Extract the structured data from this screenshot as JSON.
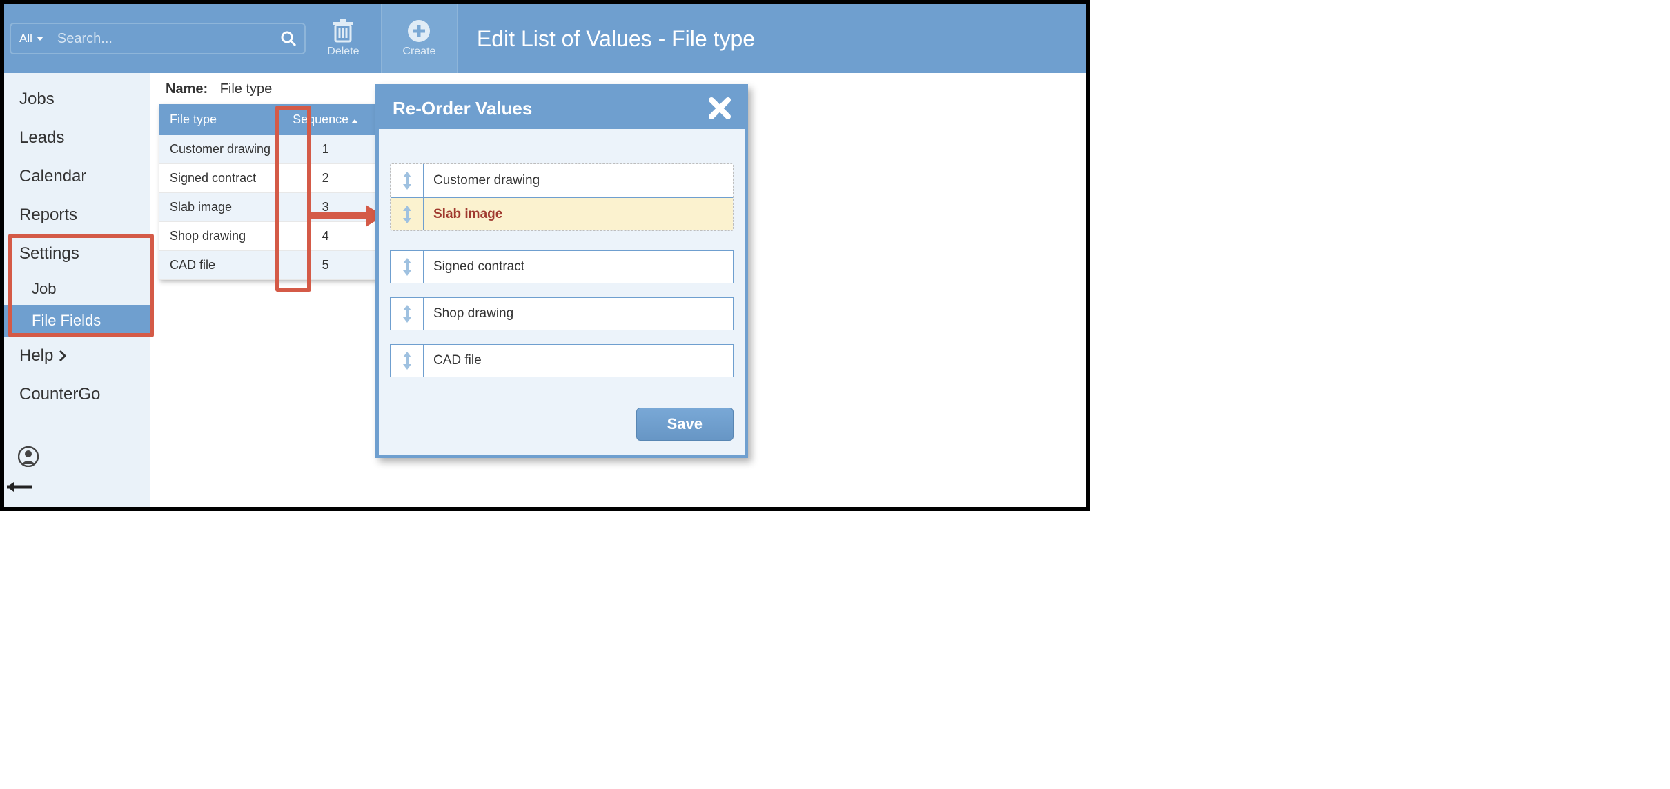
{
  "header": {
    "search_filter": "All",
    "search_placeholder": "Search...",
    "delete_label": "Delete",
    "create_label": "Create",
    "title": "Edit List of Values - File type"
  },
  "sidebar": {
    "items": [
      "Jobs",
      "Leads",
      "Calendar",
      "Reports",
      "Settings"
    ],
    "sub_items": [
      "Job",
      "File Fields"
    ],
    "help_label": "Help",
    "countergo_label": "CounterGo"
  },
  "main": {
    "name_label": "Name:",
    "name_value": "File type",
    "columns": {
      "filetype": "File type",
      "sequence": "Sequence"
    },
    "rows": [
      {
        "label": "Customer drawing",
        "seq": "1"
      },
      {
        "label": "Signed contract",
        "seq": "2"
      },
      {
        "label": "Slab image",
        "seq": "3"
      },
      {
        "label": "Shop drawing",
        "seq": "4"
      },
      {
        "label": "CAD file",
        "seq": "5"
      }
    ]
  },
  "modal": {
    "title": "Re-Order Values",
    "items": [
      "Customer drawing",
      "Slab image",
      "Signed contract",
      "Shop drawing",
      "CAD file"
    ],
    "save_label": "Save"
  }
}
